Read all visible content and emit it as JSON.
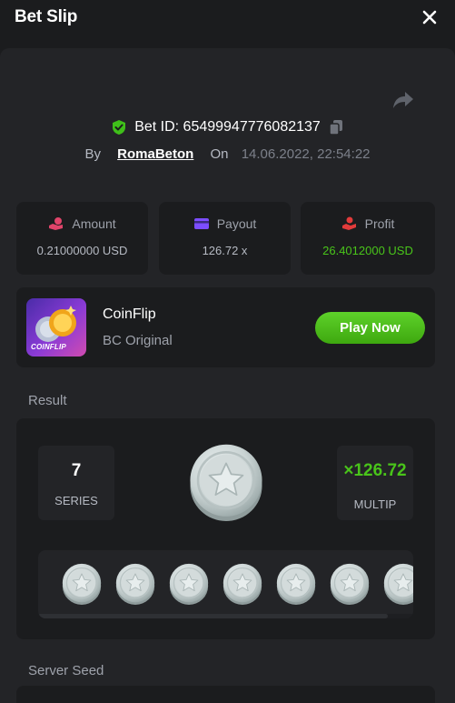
{
  "header": {
    "title": "Bet Slip"
  },
  "bet": {
    "id_text": "Bet ID: 65499947776082137",
    "by_label": "By",
    "user": "RomaBeton",
    "on_label": "On",
    "date": "14.06.2022, 22:54:22"
  },
  "stats": {
    "amount_label": "Amount",
    "amount_value": "0.21000000 USD",
    "payout_label": "Payout",
    "payout_value": "126.72 x",
    "profit_label": "Profit",
    "profit_value": "26.4012000 USD"
  },
  "game": {
    "name": "CoinFlip",
    "subtitle": "BC Original",
    "logo_text": "COINFLIP",
    "play_label": "Play Now"
  },
  "result": {
    "section_title": "Result",
    "series_value": "7",
    "series_label": "SERIES",
    "multiplier_value": "×126.72",
    "multiplier_label": "MULTIP",
    "coins": [
      "star",
      "star",
      "star",
      "star",
      "star",
      "star",
      "star"
    ]
  },
  "server_seed": {
    "section_title": "Server Seed"
  },
  "icons": {
    "close": "close-icon",
    "share": "share-icon",
    "shield": "shield-check-icon",
    "copy": "copy-icon",
    "amount": "coins-hand-icon",
    "payout": "card-icon",
    "profit": "profit-hand-icon",
    "coin": "star-coin-icon"
  },
  "colors": {
    "green": "#49c41a",
    "button_green": "#3ea80f",
    "panel": "#232427",
    "card": "#1b1c1e",
    "amount_icon": "#e0446a",
    "payout_icon": "#7c4dff",
    "profit_icon": "#e23b3b"
  }
}
